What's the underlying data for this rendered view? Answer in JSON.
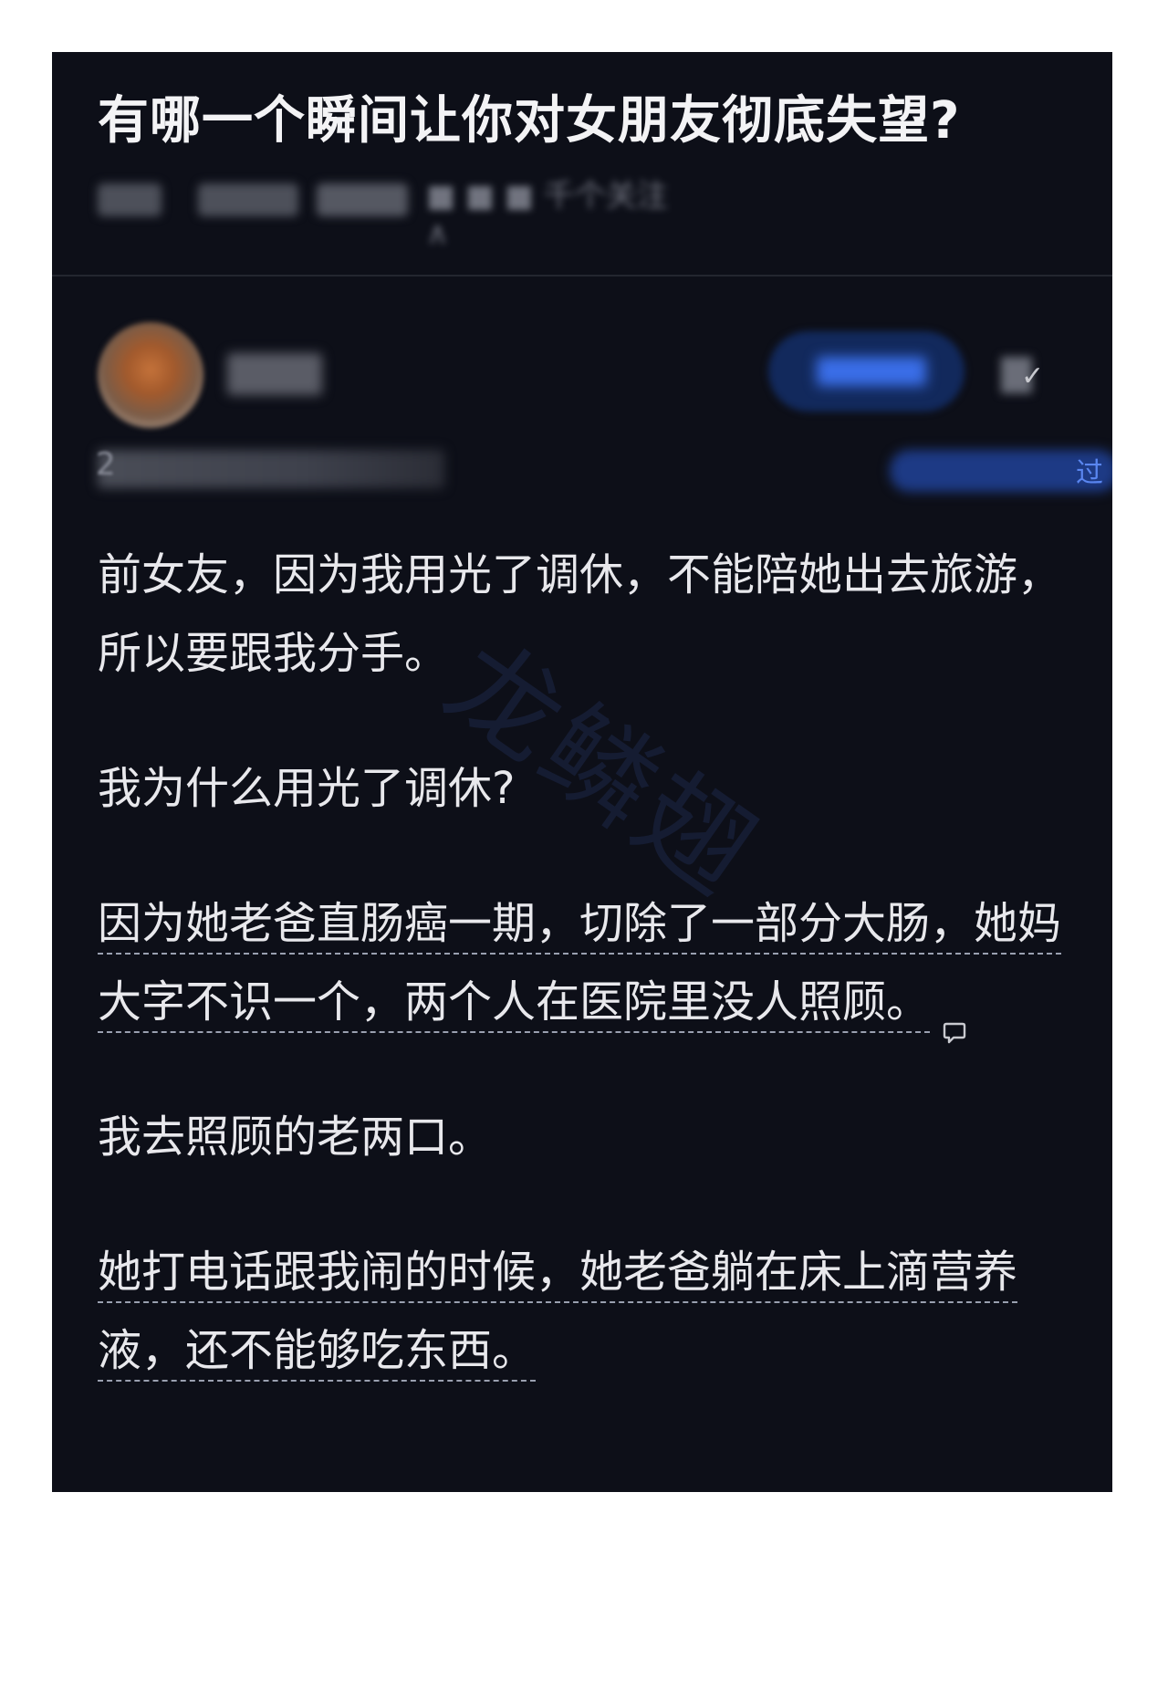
{
  "question": {
    "title": "有哪一个瞬间让你对女朋友彻底失望?",
    "meta_text": "■ ■ ■ 千个关注 ∧"
  },
  "answer": {
    "meta_digit": "2",
    "badge_text": "过",
    "paragraphs": [
      {
        "text": "前女友，因为我用光了调休，不能陪她出去旅游，所以要跟我分手。",
        "highlighted": false
      },
      {
        "text": "我为什么用光了调休?",
        "highlighted": false
      },
      {
        "text": "因为她老爸直肠癌一期，切除了一部分大肠，她妈大字不识一个，两个人在医院里没人照顾。",
        "highlighted": true,
        "has_comment_icon": true
      },
      {
        "text": "我去照顾的老两口。",
        "highlighted": false
      },
      {
        "text": "她打电话跟我闹的时候，她老爸躺在床上滴营养液，还不能够吃东西。",
        "highlighted": true
      }
    ]
  },
  "watermark": "龙鳞翅",
  "colors": {
    "card_bg": "#0d0f18",
    "text": "#e8e8ec",
    "accent_blue": "#3a6ee8"
  }
}
